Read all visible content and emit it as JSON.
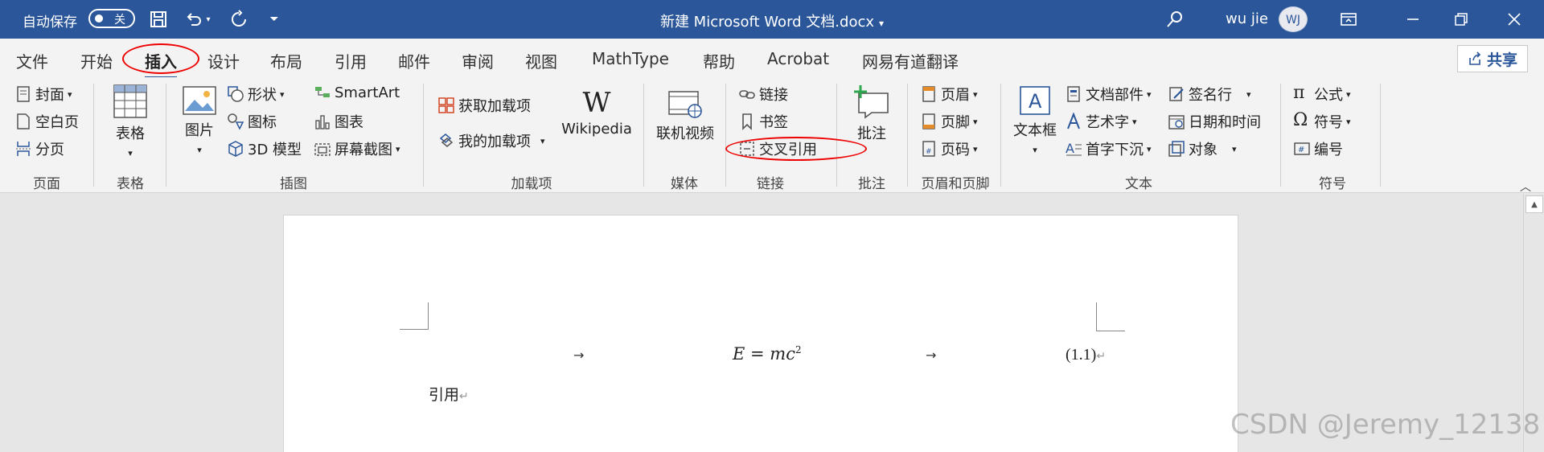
{
  "titlebar": {
    "autosave_label": "自动保存",
    "autosave_state": "关",
    "doc_title": "新建 Microsoft Word 文档.docx",
    "user_name": "wu jie",
    "avatar_initials": "WJ"
  },
  "tabs": [
    "文件",
    "开始",
    "插入",
    "设计",
    "布局",
    "引用",
    "邮件",
    "审阅",
    "视图",
    "MathType",
    "帮助",
    "Acrobat",
    "网易有道翻译"
  ],
  "active_tab": "插入",
  "share_label": "共享",
  "ribbon": {
    "pages": {
      "cover": "封面",
      "blank": "空白页",
      "break": "分页",
      "label": "页面"
    },
    "tables": {
      "table": "表格",
      "label": "表格"
    },
    "illustrations": {
      "pictures": "图片",
      "shapes": "形状",
      "icons": "图标",
      "models3d": "3D 模型",
      "smartart": "SmartArt",
      "chart": "图表",
      "screenshot": "屏幕截图",
      "label": "插图"
    },
    "addins": {
      "get": "获取加载项",
      "my": "我的加载项",
      "wikipedia": "Wikipedia",
      "label": "加载项"
    },
    "media": {
      "video": "联机视频",
      "label": "媒体"
    },
    "links": {
      "link": "链接",
      "bookmark": "书签",
      "crossref": "交叉引用",
      "label": "链接"
    },
    "comments": {
      "comment": "批注",
      "label": "批注"
    },
    "headerfooter": {
      "header": "页眉",
      "footer": "页脚",
      "pagenum": "页码",
      "label": "页眉和页脚"
    },
    "text": {
      "textbox": "文本框",
      "quickparts": "文档部件",
      "wordart": "艺术字",
      "dropcap": "首字下沉",
      "signature": "签名行",
      "datetime": "日期和时间",
      "object": "对象",
      "label": "文本"
    },
    "symbols": {
      "equation": "公式",
      "symbol": "符号",
      "number": "编号",
      "label": "符号"
    }
  },
  "document": {
    "equation_lhs": "E",
    "equation_mid": " = mc",
    "equation_exp": "2",
    "equation_number": "(1.1)",
    "citation_text": "引用",
    "tab_arrow": "→",
    "para_mark": "↵"
  },
  "watermark": "CSDN @Jeremy_12138",
  "colors": {
    "title_blue": "#2b579a",
    "annotation_red": "#e00000"
  }
}
